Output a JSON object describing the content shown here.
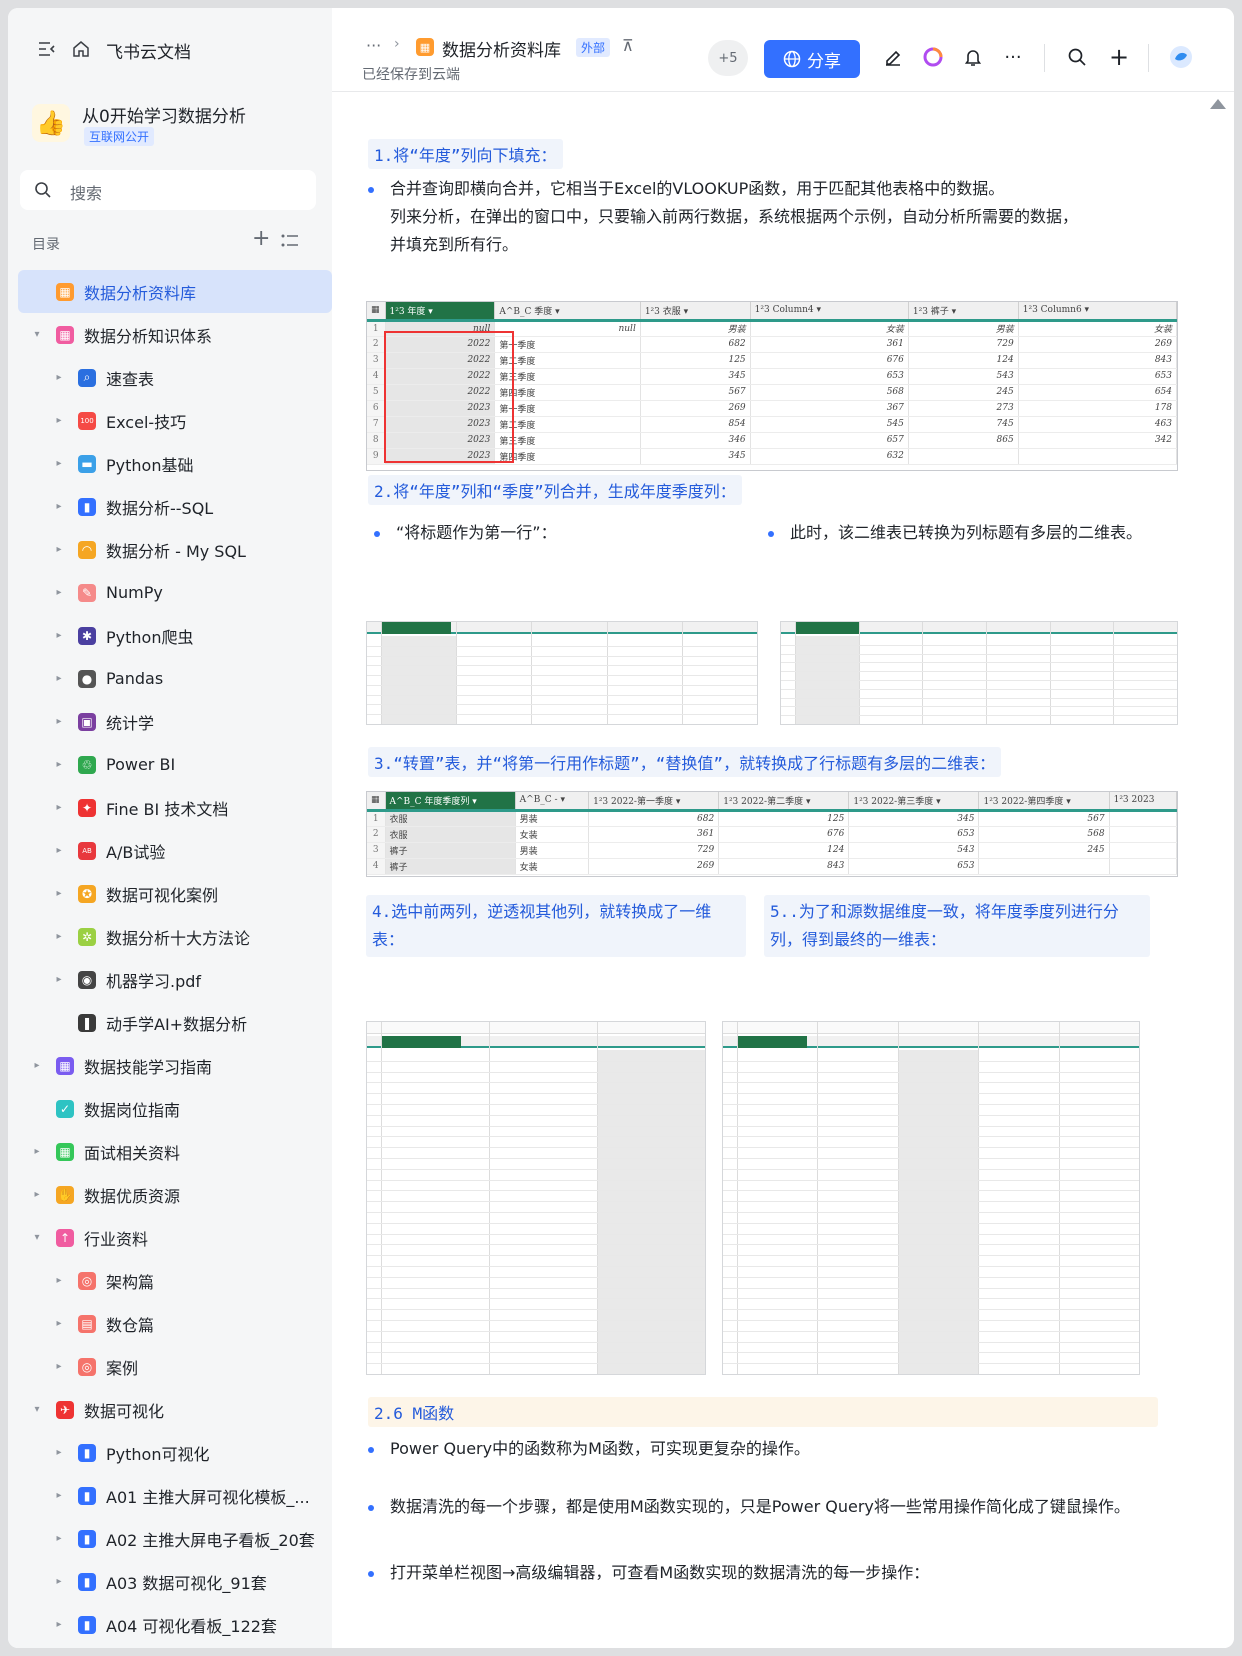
{
  "app": {
    "name": "飞书云文档",
    "collapse_icon": "sidebar-collapse-icon",
    "home_icon": "home-icon"
  },
  "workspace": {
    "title": "从0开始学习数据分析",
    "badge": "互联网公开",
    "icon": "thumbs-up-icon"
  },
  "search": {
    "placeholder": "搜索"
  },
  "toc": {
    "heading": "目录",
    "items": [
      {
        "label": "数据分析资料库",
        "level": 0,
        "active": true,
        "twisty": "",
        "icon_color": "#ff9b2f",
        "glyph": "▦"
      },
      {
        "label": "数据分析知识体系",
        "level": 0,
        "twisty": "▾",
        "icon_color": "#f05ca0",
        "glyph": "▦"
      },
      {
        "label": "速查表",
        "level": 1,
        "twisty": "▸",
        "icon_color": "#2a6fe0",
        "glyph": "⌕"
      },
      {
        "label": "Excel-技巧",
        "level": 1,
        "twisty": "▸",
        "icon_color": "#f54a45",
        "glyph": "100"
      },
      {
        "label": "Python基础",
        "level": 1,
        "twisty": "▸",
        "icon_color": "#3ba0e8",
        "glyph": "▬"
      },
      {
        "label": "数据分析--SQL",
        "level": 1,
        "twisty": "▸",
        "icon_color": "#3370ff",
        "glyph": "▮"
      },
      {
        "label": "数据分析 - My SQL",
        "level": 1,
        "twisty": "▸",
        "icon_color": "#f5a623",
        "glyph": "◠"
      },
      {
        "label": "NumPy",
        "level": 1,
        "twisty": "▸",
        "icon_color": "#f58a8a",
        "glyph": "✎"
      },
      {
        "label": "Python爬虫",
        "level": 1,
        "twisty": "▸",
        "icon_color": "#4a3fa0",
        "glyph": "✱"
      },
      {
        "label": "Pandas",
        "level": 1,
        "twisty": "▸",
        "icon_color": "#555",
        "glyph": "●"
      },
      {
        "label": "统计学",
        "level": 1,
        "twisty": "▸",
        "icon_color": "#7b3fa0",
        "glyph": "▣"
      },
      {
        "label": "Power BI",
        "level": 1,
        "twisty": "▸",
        "icon_color": "#2fa84f",
        "glyph": "♲"
      },
      {
        "label": "Fine BI 技术文档",
        "level": 1,
        "twisty": "▸",
        "icon_color": "#e33",
        "glyph": "✦"
      },
      {
        "label": "A/B试验",
        "level": 1,
        "twisty": "▸",
        "icon_color": "#e8383d",
        "glyph": "AB"
      },
      {
        "label": "数据可视化案例",
        "level": 1,
        "twisty": "▸",
        "icon_color": "#f5a623",
        "glyph": "✪"
      },
      {
        "label": "数据分析十大方法论",
        "level": 1,
        "twisty": "▸",
        "icon_color": "#9bd043",
        "glyph": "✲"
      },
      {
        "label": "机器学习.pdf",
        "level": 1,
        "twisty": "▸",
        "icon_color": "#444",
        "glyph": "◉"
      },
      {
        "label": "动手学AI+数据分析",
        "level": 1,
        "twisty": "",
        "icon_color": "#3a3a3a",
        "glyph": "❚"
      },
      {
        "label": "数据技能学习指南",
        "level": 0,
        "twisty": "▸",
        "icon_color": "#7a5cf0",
        "glyph": "▦"
      },
      {
        "label": "数据岗位指南",
        "level": 0,
        "twisty": "",
        "icon_color": "#2ec3c3",
        "glyph": "✓"
      },
      {
        "label": "面试相关资料",
        "level": 0,
        "twisty": "▸",
        "icon_color": "#34c759",
        "glyph": "▦"
      },
      {
        "label": "数据优质资源",
        "level": 0,
        "twisty": "▸",
        "icon_color": "#f5a623",
        "glyph": "✋"
      },
      {
        "label": "行业资料",
        "level": 0,
        "twisty": "▾",
        "icon_color": "#f05ca0",
        "glyph": "↑"
      },
      {
        "label": "架构篇",
        "level": 1,
        "twisty": "▸",
        "icon_color": "#f5736b",
        "glyph": "◎"
      },
      {
        "label": "数仓篇",
        "level": 1,
        "twisty": "▸",
        "icon_color": "#f5736b",
        "glyph": "▤"
      },
      {
        "label": "案例",
        "level": 1,
        "twisty": "▸",
        "icon_color": "#f5736b",
        "glyph": "◎"
      },
      {
        "label": "数据可视化",
        "level": 0,
        "twisty": "▾",
        "icon_color": "#e33",
        "glyph": "✈"
      },
      {
        "label": "Python可视化",
        "level": 1,
        "twisty": "▸",
        "icon_color": "#3370ff",
        "glyph": "▮"
      },
      {
        "label": "A01 主推大屏可视化模板_...",
        "level": 1,
        "twisty": "▸",
        "icon_color": "#3370ff",
        "glyph": "▮"
      },
      {
        "label": "A02 主推大屏电子看板_20套",
        "level": 1,
        "twisty": "▸",
        "icon_color": "#3370ff",
        "glyph": "▮"
      },
      {
        "label": "A03 数据可视化_91套",
        "level": 1,
        "twisty": "▸",
        "icon_color": "#3370ff",
        "glyph": "▮"
      },
      {
        "label": "A04 可视化看板_122套",
        "level": 1,
        "twisty": "▸",
        "icon_color": "#3370ff",
        "glyph": "▮"
      }
    ]
  },
  "header": {
    "breadcrumb_more": "···",
    "breadcrumb_sep": "›",
    "doc_title": "数据分析资料库",
    "ext_badge": "外部",
    "pin": "⊼",
    "saved": "已经保存到云端",
    "collaborators": "+5",
    "share": "分享"
  },
  "content": {
    "h1": "1.将“年度”列向下填充：",
    "b1": "合并查询即横向合并，它相当于Excel的VLOOKUP函数，用于匹配其他表格中的数据。",
    "b1_cont1": "列来分析，在弹出的窗口中，只要输入前两行数据，系统根据两个示例，自动分析所需要的数据，",
    "b1_cont2": "并填充到所有行。",
    "table1": {
      "headers": [
        "1²3 年度",
        "A^B_C 季度",
        "1²3 衣服",
        "1²3 Column4",
        "1²3 裤子",
        "1²3 Column6"
      ],
      "rows": [
        [
          "1",
          "null",
          "null",
          "男装",
          "女装",
          "男装",
          "女装"
        ],
        [
          "2",
          "2022",
          "第一季度",
          "682",
          "361",
          "729",
          "269"
        ],
        [
          "3",
          "2022",
          "第二季度",
          "125",
          "676",
          "124",
          "843"
        ],
        [
          "4",
          "2022",
          "第三季度",
          "345",
          "653",
          "543",
          "653"
        ],
        [
          "5",
          "2022",
          "第四季度",
          "567",
          "568",
          "245",
          "654"
        ],
        [
          "6",
          "2023",
          "第一季度",
          "269",
          "367",
          "273",
          "178"
        ],
        [
          "7",
          "2023",
          "第二季度",
          "854",
          "545",
          "745",
          "463"
        ],
        [
          "8",
          "2023",
          "第三季度",
          "346",
          "657",
          "865",
          "342"
        ],
        [
          "9",
          "2023",
          "第四季度",
          "345",
          "632",
          "",
          ""
        ]
      ]
    },
    "h2": "2.将“年度”列和“季度”列合并，生成年度季度列：",
    "b2a": "“将标题作为第一行”：",
    "b2b": "此时，该二维表已转换为列标题有多层的二维表。",
    "h3": "3.“转置”表，并“将第一行用作标题”，“替换值”，就转换成了行标题有多层的二维表：",
    "table3": {
      "headers": [
        "A^B_C 年度季度列",
        "A^B_C -",
        "1²3 2022-第一季度",
        "1²3 2022-第二季度",
        "1²3 2022-第三季度",
        "1²3 2022-第四季度",
        "1²3 2023"
      ],
      "rows": [
        [
          "1",
          "衣服",
          "男装",
          "682",
          "125",
          "345",
          "567",
          ""
        ],
        [
          "2",
          "衣服",
          "女装",
          "361",
          "676",
          "653",
          "568",
          ""
        ],
        [
          "3",
          "裤子",
          "男装",
          "729",
          "124",
          "543",
          "245",
          ""
        ],
        [
          "4",
          "裤子",
          "女装",
          "269",
          "843",
          "653",
          "",
          ""
        ]
      ]
    },
    "h4": "4.选中前两列，逆透视其他列，就转换成了一维表：",
    "h5": "5..为了和源数据维度一致，将年度季度列进行分列，得到最终的一维表：",
    "h6": "2.6 M函数",
    "b6a": "Power Query中的函数称为M函数，可实现更复杂的操作。",
    "b6b": "数据清洗的每一个步骤，都是使用M函数实现的，只是Power Query将一些常用操作简化成了键鼠操作。",
    "b6c": "打开菜单栏视图→高级编辑器，可查看M函数实现的数据清洗的每一步操作："
  },
  "colors": {
    "accent": "#3370ff",
    "active_bg": "#d7e3fb",
    "heading": "#245bdb",
    "excel_green": "#217346",
    "teal": "#2e9a8a",
    "red_box": "#e33333"
  }
}
